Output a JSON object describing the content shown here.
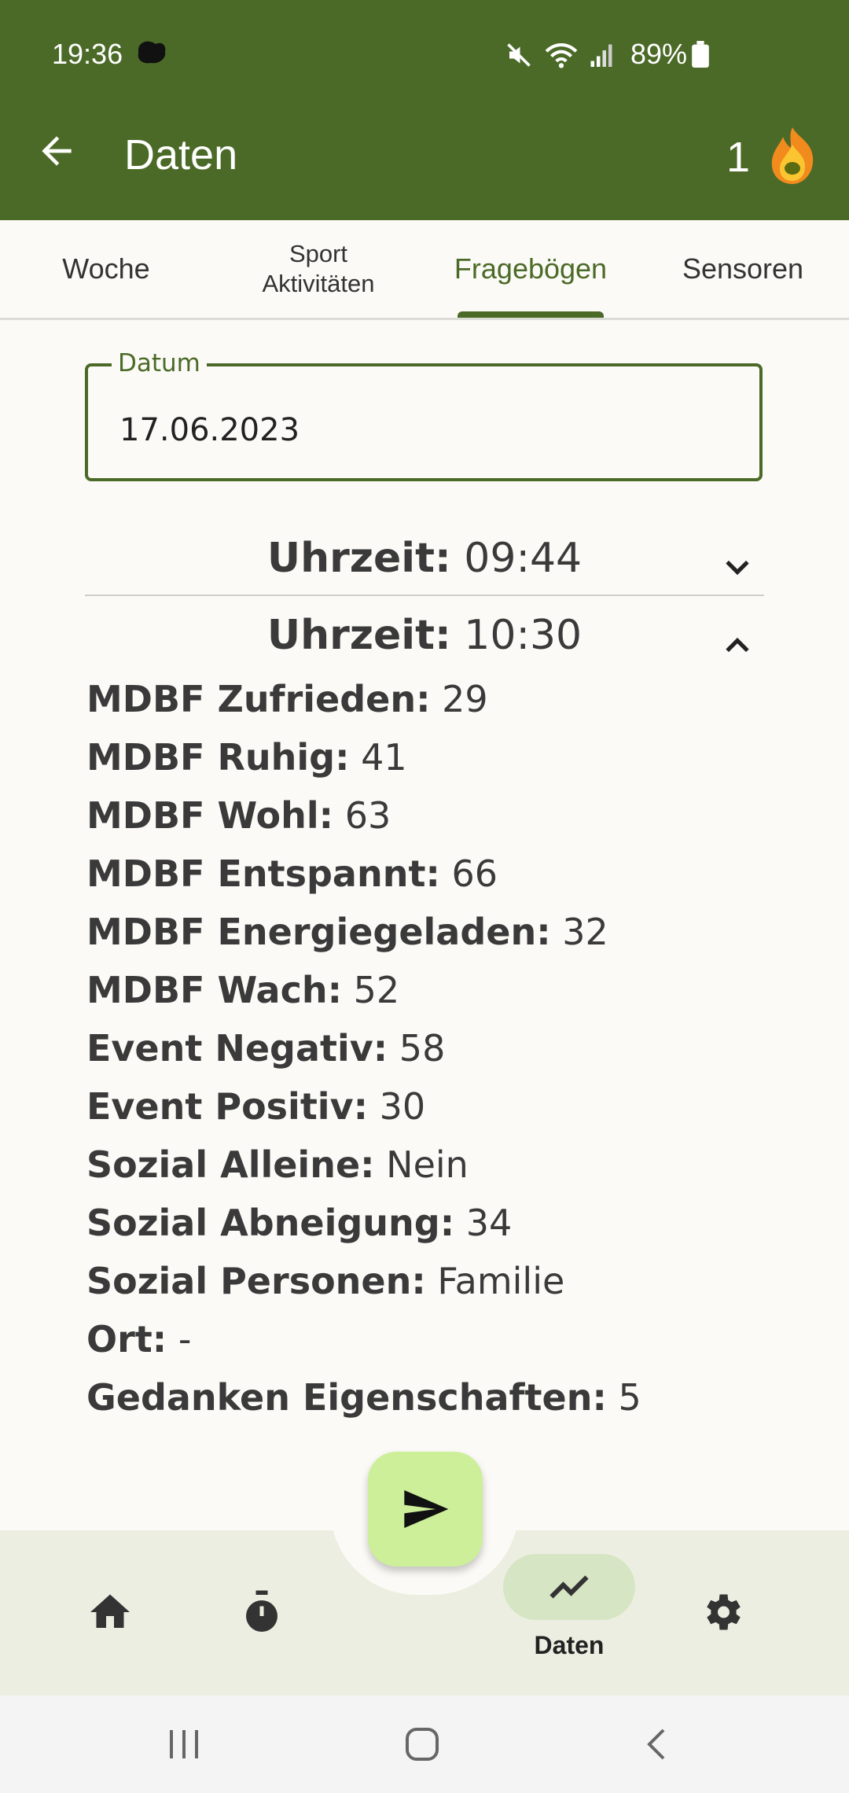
{
  "status_bar": {
    "time": "19:36",
    "battery_percent": "89%"
  },
  "app_bar": {
    "title": "Daten",
    "streak_count": "1"
  },
  "tabs": [
    {
      "label": "Woche"
    },
    {
      "label_line1": "Sport",
      "label_line2": "Aktivitäten"
    },
    {
      "label": "Fragebögen",
      "active": true
    },
    {
      "label": "Sensoren"
    }
  ],
  "date_field": {
    "label": "Datum",
    "value": "17.06.2023"
  },
  "entries": [
    {
      "time_label": "Uhrzeit:",
      "time": "09:44",
      "expanded": false
    },
    {
      "time_label": "Uhrzeit:",
      "time": "10:30",
      "expanded": true
    }
  ],
  "answers": [
    {
      "key": "MDBF Zufrieden:",
      "value": "29"
    },
    {
      "key": "MDBF Ruhig:",
      "value": "41"
    },
    {
      "key": "MDBF Wohl:",
      "value": "63"
    },
    {
      "key": "MDBF Entspannt:",
      "value": "66"
    },
    {
      "key": "MDBF Energiegeladen:",
      "value": "32"
    },
    {
      "key": "MDBF Wach:",
      "value": "52"
    },
    {
      "key": "Event Negativ:",
      "value": "58"
    },
    {
      "key": "Event Positiv:",
      "value": "30"
    },
    {
      "key": "Sozial Alleine:",
      "value": "Nein"
    },
    {
      "key": "Sozial Abneigung:",
      "value": "34"
    },
    {
      "key": "Sozial Personen:",
      "value": "Familie"
    },
    {
      "key": "Ort:",
      "value": "-"
    },
    {
      "key": "Gedanken Eigenschaften:",
      "value": "5"
    }
  ],
  "bottom_nav": {
    "items": [
      "home-icon",
      "timer-icon",
      "chart-icon",
      "settings-icon"
    ],
    "active_label": "Daten"
  },
  "colors": {
    "primary": "#4b6a27",
    "fab": "#cdef9a",
    "nav_bg": "#eceee1",
    "pill": "#d6e6c4"
  }
}
